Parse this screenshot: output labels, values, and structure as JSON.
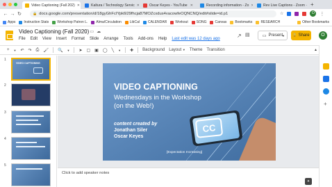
{
  "browser": {
    "tabs": [
      {
        "label": "Video Captioning (Fall 202)",
        "color": "#f4b400",
        "active": true
      },
      {
        "label": "Kaltura / Technology Servic",
        "color": "#1a73e8",
        "active": false
      },
      {
        "label": "Oscar Keyes - YouTube",
        "color": "#e53935",
        "active": false
      },
      {
        "label": "Recording information - Zo",
        "color": "#1e88e5",
        "active": false
      },
      {
        "label": "Rev Live Captions - Zoom ·",
        "color": "#1e88e5",
        "active": false
      }
    ],
    "new_tab": "+",
    "url": "docs.google.com/presentation/d/18gyGhFcIYpk6l29fhcja87MOZcxdus4vacowfeOQNCNQ/edit#slide=id.p1",
    "profile_initial": "O"
  },
  "bookmarks": {
    "items": [
      {
        "label": "Apps",
        "color": "#4285f4"
      },
      {
        "label": "Instruction Stats",
        "color": "#1e88e5"
      },
      {
        "label": "Workshop Patron L.",
        "color": "#43a047"
      },
      {
        "label": "Alma/Circulation",
        "color": "#8e24aa"
      },
      {
        "label": "LibCal",
        "color": "#fb8c00"
      },
      {
        "label": "CALENDAR",
        "color": "#1e88e5"
      },
      {
        "label": "Workout",
        "color": "#e53935"
      },
      {
        "label": "SONG",
        "color": "#e53935"
      },
      {
        "label": "Canvas",
        "color": "#e53935"
      },
      {
        "label": "Bookmarks",
        "color": "#fbc02d"
      },
      {
        "label": "RESEARCH",
        "color": "#fbc02d"
      }
    ],
    "other": "Other Bookmarks"
  },
  "doc": {
    "title": "Video Captioning (Fall 2020)",
    "menus": [
      "File",
      "Edit",
      "View",
      "Insert",
      "Format",
      "Slide",
      "Arrange",
      "Tools",
      "Add-ons",
      "Help"
    ],
    "last_edit": "Last edit was 12 days ago",
    "present_label": "Present",
    "share_label": "Share",
    "avatar_initial": "O"
  },
  "toolbar": {
    "background": "Background",
    "layout": "Layout",
    "theme": "Theme",
    "transition": "Transition"
  },
  "slides": [
    {
      "number": "1",
      "heading": "VIDEO CAPTIONING"
    },
    {
      "number": "2",
      "heading": ""
    },
    {
      "number": "3",
      "heading": ""
    },
    {
      "number": "4",
      "heading": ""
    },
    {
      "number": "5",
      "heading": ""
    }
  ],
  "slide": {
    "title": "VIDEO CAPTIONING",
    "subtitle_line1": "Wednesdays in the Workshop",
    "subtitle_line2": "(on the Web!)",
    "credit_label": "content created by",
    "author1": "Jonathan Siler",
    "author2": "Oscar Keyes",
    "cc": "CC",
    "footer": "[Expectation Increasing]"
  },
  "notes": {
    "placeholder": "Click to add speaker notes"
  },
  "colors": {
    "accent": "#f4b400",
    "slide_bg": "#5b86b6",
    "link": "#1a73e8"
  }
}
